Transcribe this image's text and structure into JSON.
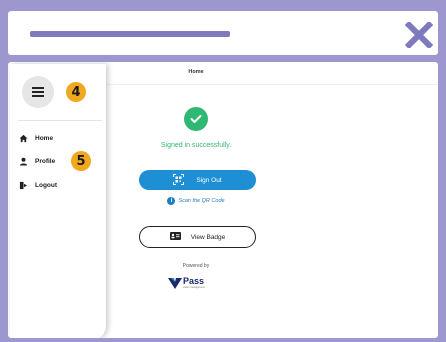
{
  "header": {
    "close_icon": "close-icon",
    "frame_color": "#9c97cf"
  },
  "sidebar": {
    "menu_icon": "hamburger-menu-icon",
    "badge_menu": "4",
    "badge_profile": "5",
    "items": [
      {
        "label": "Home",
        "icon": "home-icon"
      },
      {
        "label": "Profile",
        "icon": "user-icon"
      },
      {
        "label": "Logout",
        "icon": "logout-icon"
      }
    ]
  },
  "main": {
    "page_title": "Home",
    "success_message": "Signed in successfully.",
    "signout_label": "Sign Out",
    "scan_label": "Scan the QR Code",
    "view_badge_label": "View Badge",
    "powered_by": "Powered by",
    "logo_text": "Pass",
    "logo_subtext": "visitor management"
  },
  "colors": {
    "accent": "#1e8fd5",
    "success": "#2eb872",
    "badge": "#f0a81f"
  }
}
